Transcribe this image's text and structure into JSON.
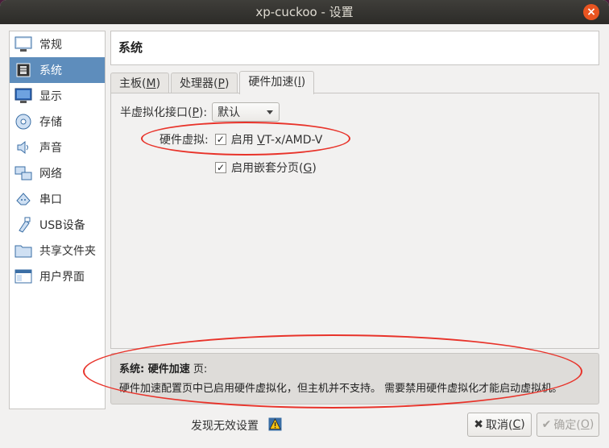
{
  "window": {
    "title": "xp-cuckoo - 设置",
    "close_glyph": "×"
  },
  "sidebar": {
    "items": [
      {
        "label": "常规",
        "icon": "general-icon",
        "active": false
      },
      {
        "label": "系统",
        "icon": "system-icon",
        "active": true
      },
      {
        "label": "显示",
        "icon": "display-icon",
        "active": false
      },
      {
        "label": "存储",
        "icon": "storage-icon",
        "active": false
      },
      {
        "label": "声音",
        "icon": "audio-icon",
        "active": false
      },
      {
        "label": "网络",
        "icon": "network-icon",
        "active": false
      },
      {
        "label": "串口",
        "icon": "serial-port-icon",
        "active": false
      },
      {
        "label": "USB设备",
        "icon": "usb-icon",
        "active": false
      },
      {
        "label": "共享文件夹",
        "icon": "shared-folder-icon",
        "active": false
      },
      {
        "label": "用户界面",
        "icon": "user-interface-icon",
        "active": false
      }
    ]
  },
  "page": {
    "title": "系统"
  },
  "tabs": [
    {
      "label": "主板",
      "mnemonic": "M",
      "active": false
    },
    {
      "label": "处理器",
      "mnemonic": "P",
      "active": false
    },
    {
      "label": "硬件加速",
      "mnemonic": "l",
      "active": true
    }
  ],
  "acceleration": {
    "paravirt_label": "半虚拟化接口(",
    "paravirt_mnemonic": "P",
    "paravirt_suffix": "):",
    "paravirt_value": "默认",
    "hw_virt_label": "硬件虚拟:",
    "vtx_prefix": "启用 ",
    "vtx_mnemonic": "V",
    "vtx_suffix": "T-x/AMD-V",
    "vtx_checked": true,
    "nested_prefix": "启用嵌套分页(",
    "nested_mnemonic": "G",
    "nested_suffix": ")",
    "nested_checked": true,
    "check_glyph": "✓"
  },
  "info_panel": {
    "title_bold": "系统: 硬件加速",
    "title_suffix": " 页:",
    "message": "硬件加速配置页中已启用硬件虚拟化，但主机并不支持。 需要禁用硬件虚拟化才能启动虚拟机。"
  },
  "footer": {
    "invalid_settings": "发现无效设置",
    "cancel_label": "取消(",
    "cancel_mnemonic": "C",
    "cancel_suffix": ")",
    "ok_label": "确定(",
    "ok_mnemonic": "O",
    "ok_suffix": ")"
  },
  "colors": {
    "accent": "#5e8dbc",
    "annotation": "#e8332a",
    "close": "#e95420"
  }
}
